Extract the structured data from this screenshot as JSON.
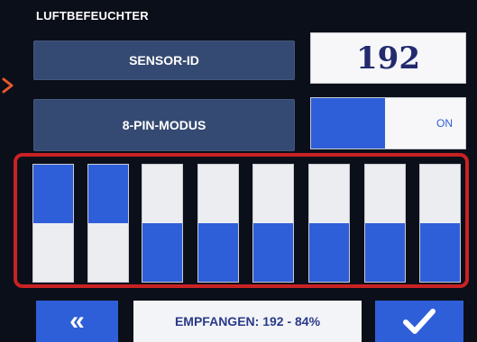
{
  "header": {
    "title": "LUFTBEFEUCHTER"
  },
  "sensor": {
    "label": "SENSOR-ID",
    "value": "192"
  },
  "pin_mode": {
    "label": "8-PIN-MODUS",
    "state": "ON",
    "on": true
  },
  "pins": [
    {
      "level": "high"
    },
    {
      "level": "high"
    },
    {
      "level": "low"
    },
    {
      "level": "low"
    },
    {
      "level": "low"
    },
    {
      "level": "low"
    },
    {
      "level": "low"
    },
    {
      "level": "low"
    }
  ],
  "footer": {
    "back_icon": "double-chevron-left-icon",
    "status": "EMPFANGEN: 192 - 84%",
    "confirm_icon": "checkmark-icon"
  },
  "colors": {
    "accent": "#2f5fd8",
    "panel": "#354a72",
    "highlight": "#c92224",
    "background": "#0b0f19"
  }
}
